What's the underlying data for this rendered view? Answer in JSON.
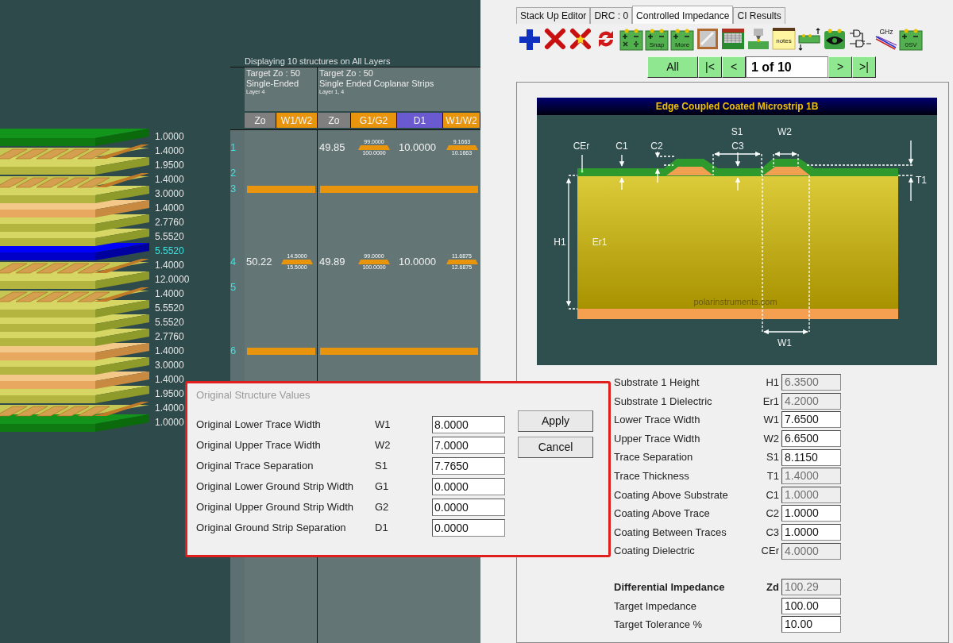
{
  "stackup": {
    "layers": [
      {
        "thickness": "1.0000",
        "kind": "mask",
        "selected": false
      },
      {
        "thickness": "1.4000",
        "kind": "signal",
        "selected": false
      },
      {
        "thickness": "1.9500",
        "kind": "dielectric",
        "selected": false
      },
      {
        "thickness": "1.4000",
        "kind": "signal",
        "selected": false
      },
      {
        "thickness": "3.0000",
        "kind": "dielectric",
        "selected": false
      },
      {
        "thickness": "1.4000",
        "kind": "plane",
        "selected": false
      },
      {
        "thickness": "2.7760",
        "kind": "dielectric",
        "selected": false
      },
      {
        "thickness": "5.5520",
        "kind": "dielectric",
        "selected": false
      },
      {
        "thickness": "5.5520",
        "kind": "dielectric",
        "selected": true
      },
      {
        "thickness": "1.4000",
        "kind": "signal",
        "selected": false
      },
      {
        "thickness": "12.0000",
        "kind": "dielectric",
        "selected": false
      },
      {
        "thickness": "1.4000",
        "kind": "signal",
        "selected": false
      },
      {
        "thickness": "5.5520",
        "kind": "dielectric",
        "selected": false
      },
      {
        "thickness": "5.5520",
        "kind": "dielectric",
        "selected": false
      },
      {
        "thickness": "2.7760",
        "kind": "dielectric",
        "selected": false
      },
      {
        "thickness": "1.4000",
        "kind": "plane",
        "selected": false
      },
      {
        "thickness": "3.0000",
        "kind": "dielectric",
        "selected": false
      },
      {
        "thickness": "1.4000",
        "kind": "plane",
        "selected": false
      },
      {
        "thickness": "1.9500",
        "kind": "dielectric",
        "selected": false
      },
      {
        "thickness": "1.4000",
        "kind": "signal",
        "selected": false
      },
      {
        "thickness": "1.0000",
        "kind": "mask",
        "selected": false
      }
    ]
  },
  "table": {
    "caption": "Displaying 10 structures on All Layers",
    "structures": [
      {
        "target": "Target Zo : 50",
        "type": "Single-Ended",
        "layers": "Layer 4",
        "columns": [
          {
            "label": "Zo",
            "color": "#7f7f7f"
          },
          {
            "label": "W1/W2",
            "color": "#e8940c"
          }
        ]
      },
      {
        "target": "Target Zo : 50",
        "type": "Single Ended Coplanar Strips",
        "layers": "Layer 1, 4",
        "columns": [
          {
            "label": "Zo",
            "color": "#7f7f7f"
          },
          {
            "label": "G1/G2",
            "color": "#e8940c"
          },
          {
            "label": "D1",
            "color": "#6a5ad0"
          },
          {
            "label": "W1/W2",
            "color": "#e8940c"
          }
        ]
      }
    ],
    "rows": [
      {
        "kind": "signal",
        "number": "1",
        "cells": [
          {
            "kind": "blank"
          },
          {
            "kind": "blank"
          },
          {
            "kind": "text",
            "text": "49.85"
          },
          {
            "kind": "trace",
            "upper": "99.0000",
            "lower": "100.0000"
          },
          {
            "kind": "text",
            "text": "10.0000"
          },
          {
            "kind": "trace",
            "upper": "9.1663",
            "lower": "10.1663"
          }
        ]
      },
      {
        "kind": "layer",
        "number": "2"
      },
      {
        "kind": "plane",
        "number": "3"
      },
      {
        "kind": "gap"
      },
      {
        "kind": "gap"
      },
      {
        "kind": "signal",
        "number": "4",
        "cells": [
          {
            "kind": "text",
            "text": "50.22"
          },
          {
            "kind": "trace",
            "upper": "14.5000",
            "lower": "15.5000"
          },
          {
            "kind": "text",
            "text": "49.89"
          },
          {
            "kind": "trace",
            "upper": "99.0000",
            "lower": "100.0000"
          },
          {
            "kind": "text",
            "text": "10.0000"
          },
          {
            "kind": "trace",
            "upper": "11.6875",
            "lower": "12.6875"
          }
        ]
      },
      {
        "kind": "layer",
        "number": "5"
      },
      {
        "kind": "gap"
      },
      {
        "kind": "gap"
      },
      {
        "kind": "plane",
        "number": "6"
      }
    ]
  },
  "tabs": [
    {
      "label": "Stack Up Editor",
      "selected": false
    },
    {
      "label": "DRC : 0",
      "selected": false
    },
    {
      "label": "Controlled Impedance",
      "selected": true
    },
    {
      "label": "CI Results",
      "selected": false
    }
  ],
  "toolbar": [
    {
      "kind": "add"
    },
    {
      "kind": "delete"
    },
    {
      "kind": "delete-star"
    },
    {
      "kind": "swap"
    },
    {
      "kind": "calc"
    },
    {
      "kind": "calc",
      "label": "Snap"
    },
    {
      "kind": "calc",
      "label": "More"
    },
    {
      "kind": "mirror"
    },
    {
      "kind": "board"
    },
    {
      "kind": "probe"
    },
    {
      "kind": "notes",
      "label": "notes"
    },
    {
      "kind": "resize"
    },
    {
      "kind": "eye"
    },
    {
      "kind": "logic"
    },
    {
      "kind": "freq",
      "label": "GHz"
    },
    {
      "kind": "calc",
      "label": "0SV"
    }
  ],
  "navigator": [
    {
      "kind": "button",
      "label": "All"
    },
    {
      "kind": "button",
      "label": "|<"
    },
    {
      "kind": "button",
      "label": "<"
    },
    {
      "kind": "field",
      "value": "1 of 10"
    },
    {
      "kind": "button",
      "label": ">"
    },
    {
      "kind": "button",
      "label": ">|"
    }
  ],
  "diagram": {
    "title": "Edge Coupled Coated Microstrip 1B",
    "labels": [
      "CEr",
      "C1",
      "C2",
      "S1",
      "C3",
      "W2",
      "T1",
      "H1",
      "Er1",
      "W1"
    ],
    "credit": "polarinstruments.com"
  },
  "parameters": [
    {
      "label": "Substrate 1 Height",
      "symbol": "H1",
      "value": "6.3500",
      "disabled": true
    },
    {
      "label": "Substrate 1 Dielectric",
      "symbol": "Er1",
      "value": "4.2000",
      "disabled": true
    },
    {
      "label": "Lower Trace Width",
      "symbol": "W1",
      "value": "7.6500",
      "disabled": false
    },
    {
      "label": "Upper Trace Width",
      "symbol": "W2",
      "value": "6.6500",
      "disabled": false
    },
    {
      "label": "Trace Separation",
      "symbol": "S1",
      "value": "8.1150",
      "disabled": false
    },
    {
      "label": "Trace Thickness",
      "symbol": "T1",
      "value": "1.4000",
      "disabled": true
    },
    {
      "label": "Coating Above Substrate",
      "symbol": "C1",
      "value": "1.0000",
      "disabled": true
    },
    {
      "label": "Coating Above Trace",
      "symbol": "C2",
      "value": "1.0000",
      "disabled": false
    },
    {
      "label": "Coating Between Traces",
      "symbol": "C3",
      "value": "1.0000",
      "disabled": false
    },
    {
      "label": "Coating Dielectric",
      "symbol": "CEr",
      "value": "4.0000",
      "disabled": true
    }
  ],
  "results": [
    {
      "kind": "result",
      "label": "Differential Impedance",
      "symbol": "Zd",
      "value": "100.29",
      "disabled": true
    },
    {
      "kind": "target",
      "label": "Target Impedance",
      "value": "100.00",
      "disabled": false
    },
    {
      "kind": "target",
      "label": "Target Tolerance %",
      "value": "10.00",
      "disabled": false
    }
  ],
  "dialog": {
    "title": "Original Structure Values",
    "fields": [
      {
        "label": "Original Lower Trace Width",
        "symbol": "W1",
        "value": "8.0000"
      },
      {
        "label": "Original Upper Trace Width",
        "symbol": "W2",
        "value": "7.0000"
      },
      {
        "label": "Original Trace Separation",
        "symbol": "S1",
        "value": "7.7650"
      },
      {
        "label": "Original Lower Ground Strip Width",
        "symbol": "G1",
        "value": "0.0000"
      },
      {
        "label": "Original Upper Ground Strip Width",
        "symbol": "G2",
        "value": "0.0000"
      },
      {
        "label": "Original Ground Strip Separation",
        "symbol": "D1",
        "value": "0.0000"
      }
    ],
    "buttons": [
      "Apply",
      "Cancel"
    ]
  }
}
